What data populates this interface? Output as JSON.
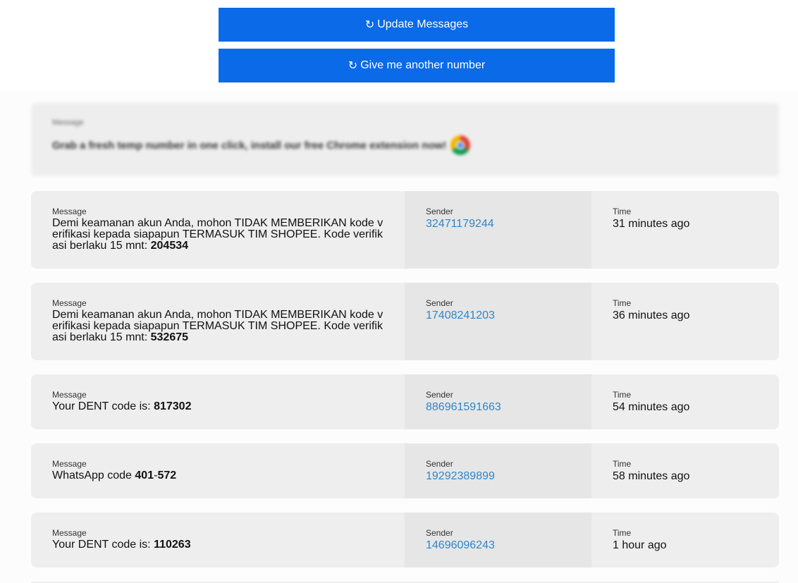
{
  "buttons": {
    "update": {
      "icon": "↻",
      "label": "Update Messages"
    },
    "another": {
      "icon": "↻",
      "label": "Give me another number"
    }
  },
  "promo": {
    "label": "Message",
    "text": "Grab a fresh temp number in one click, install our free Chrome extension now!",
    "icon": "chrome-logo"
  },
  "labels": {
    "message": "Message",
    "sender": "Sender",
    "time": "Time"
  },
  "messages": [
    {
      "text_prefix": "Demi keamanan akun Anda, mohon TIDAK MEMBERIKAN kode verifikasi kepada siapapun TERMASUK TIM SHOPEE. Kode verifikasi berlaku 15 mnt: ",
      "code": "204534",
      "sender": "32471179244",
      "time": "31 minutes ago"
    },
    {
      "text_prefix": "Demi keamanan akun Anda, mohon TIDAK MEMBERIKAN kode verifikasi kepada siapapun TERMASUK TIM SHOPEE. Kode verifikasi berlaku 15 mnt: ",
      "code": "532675",
      "sender": "17408241203",
      "time": "36 minutes ago"
    },
    {
      "text_prefix": "Your DENT code is: ",
      "code": "817302",
      "sender": "886961591663",
      "time": "54 minutes ago"
    },
    {
      "text_prefix": "WhatsApp code ",
      "code_a": "401",
      "code_sep": "-",
      "code_b": "572",
      "sender": "19292389899",
      "time": "58 minutes ago"
    },
    {
      "text_prefix": "Your DENT code is: ",
      "code": "110263",
      "sender": "14696096243",
      "time": "1 hour ago"
    }
  ],
  "colors": {
    "button": "#0a6ae8",
    "link": "#2e86c8",
    "card": "#eeeeee",
    "sender_column": "#e6e6e6"
  }
}
